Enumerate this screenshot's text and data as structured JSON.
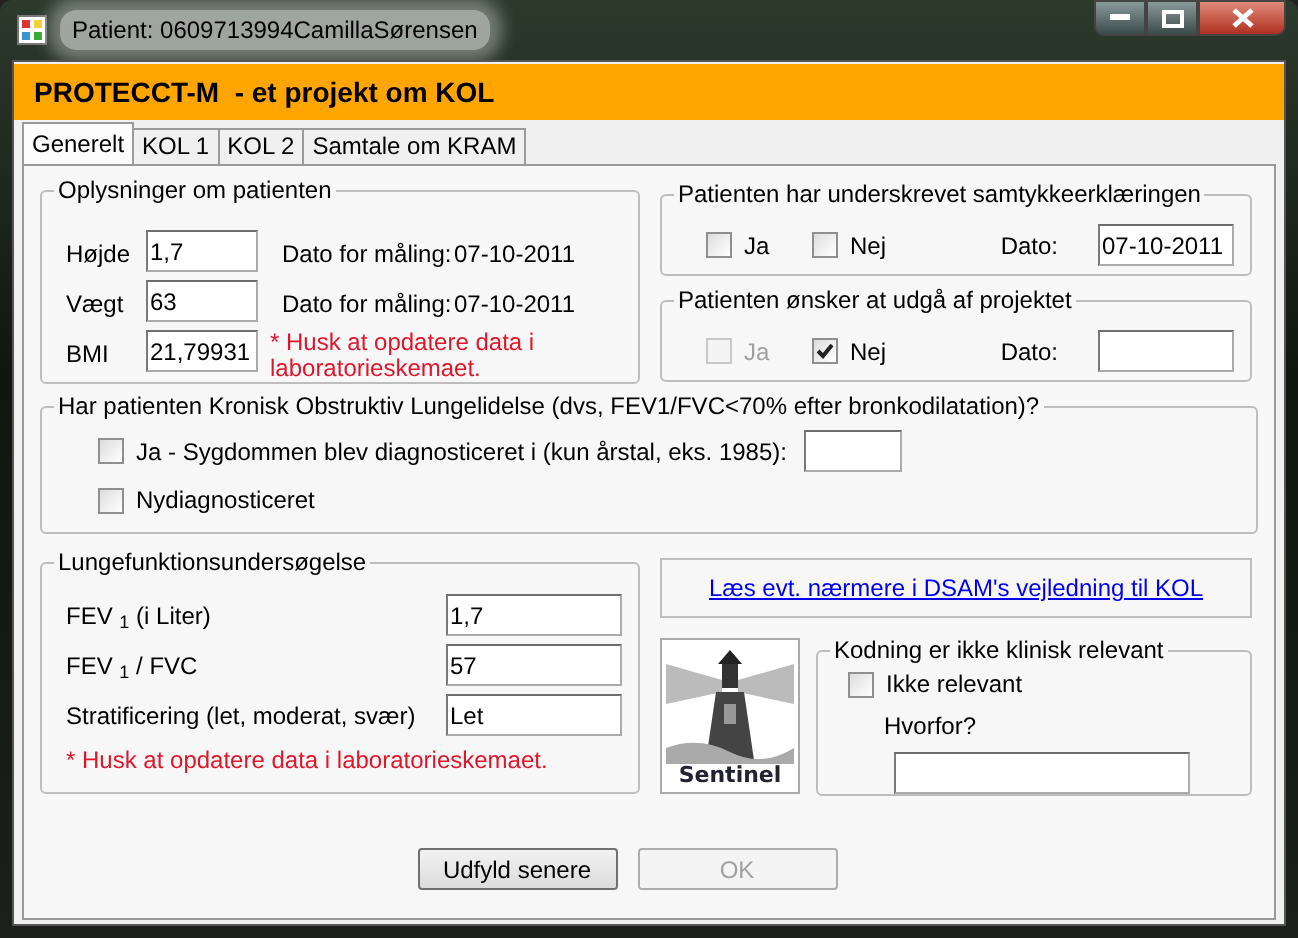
{
  "window": {
    "title": "Patient: 0609713994CamillaSørensen"
  },
  "header": {
    "title": "PROTECCT-M  - et projekt om KOL"
  },
  "tabs": [
    {
      "label": "Generelt",
      "selected": true
    },
    {
      "label": "KOL 1",
      "selected": false
    },
    {
      "label": "KOL 2",
      "selected": false
    },
    {
      "label": "Samtale om KRAM",
      "selected": false
    }
  ],
  "patient_info": {
    "title": "Oplysninger om patienten",
    "rows": [
      {
        "label": "Højde",
        "value": "1,7",
        "date_label": "Dato for måling:",
        "date": "07-10-2011"
      },
      {
        "label": "Vægt",
        "value": "63",
        "date_label": "Dato for måling:",
        "date": "07-10-2011"
      },
      {
        "label": "BMI",
        "value": "21,79931",
        "note": "* Husk at opdatere data i laboratorieskemaet."
      }
    ]
  },
  "consent": {
    "title": "Patienten har underskrevet samtykkeerklæringen",
    "options": [
      {
        "label": "Ja",
        "checked": false,
        "disabled": false
      },
      {
        "label": "Nej",
        "checked": false,
        "disabled": false
      }
    ],
    "date_label": "Dato:",
    "date": "07-10-2011"
  },
  "withdraw": {
    "title": "Patienten ønsker at udgå af projektet",
    "options": [
      {
        "label": "Ja",
        "checked": false,
        "disabled": true
      },
      {
        "label": "Nej",
        "checked": true,
        "disabled": false
      }
    ],
    "date_label": "Dato:"
  },
  "kol": {
    "title": "Har patienten Kronisk Obstruktiv Lungelidelse (dvs, FEV1/FVC<70% efter bronkodilatation)?",
    "options": [
      {
        "kind": "with_field",
        "label": "Ja - Sygdommen blev diagnosticeret i (kun årstal, eks. 1985):",
        "checked": false
      },
      {
        "kind": "plain",
        "label": "Nydiagnosticeret",
        "checked": false
      }
    ]
  },
  "lung": {
    "title": "Lungefunktionsundersøgelse",
    "rows": [
      {
        "label": "FEV $_{1}$ (i Liter)",
        "value": "1,7"
      },
      {
        "label": "FEV $_{1}$ / FVC",
        "value": "57"
      },
      {
        "label": "Stratificering (let, moderat, svær)",
        "value": "Let"
      }
    ],
    "note": "* Husk at opdatere data i laboratorieskemaet."
  },
  "link": {
    "text": "Læs evt. nærmere i DSAM's vejledning til KOL"
  },
  "logo": {
    "text": "Sentinel"
  },
  "coding": {
    "title": "Kodning er ikke klinisk relevant",
    "checkbox": {
      "label": "Ikke relevant",
      "checked": false
    },
    "why_label": "Hvorfor?"
  },
  "buttons": [
    {
      "label": "Udfyld senere",
      "disabled": false
    },
    {
      "label": "OK",
      "disabled": true
    }
  ]
}
